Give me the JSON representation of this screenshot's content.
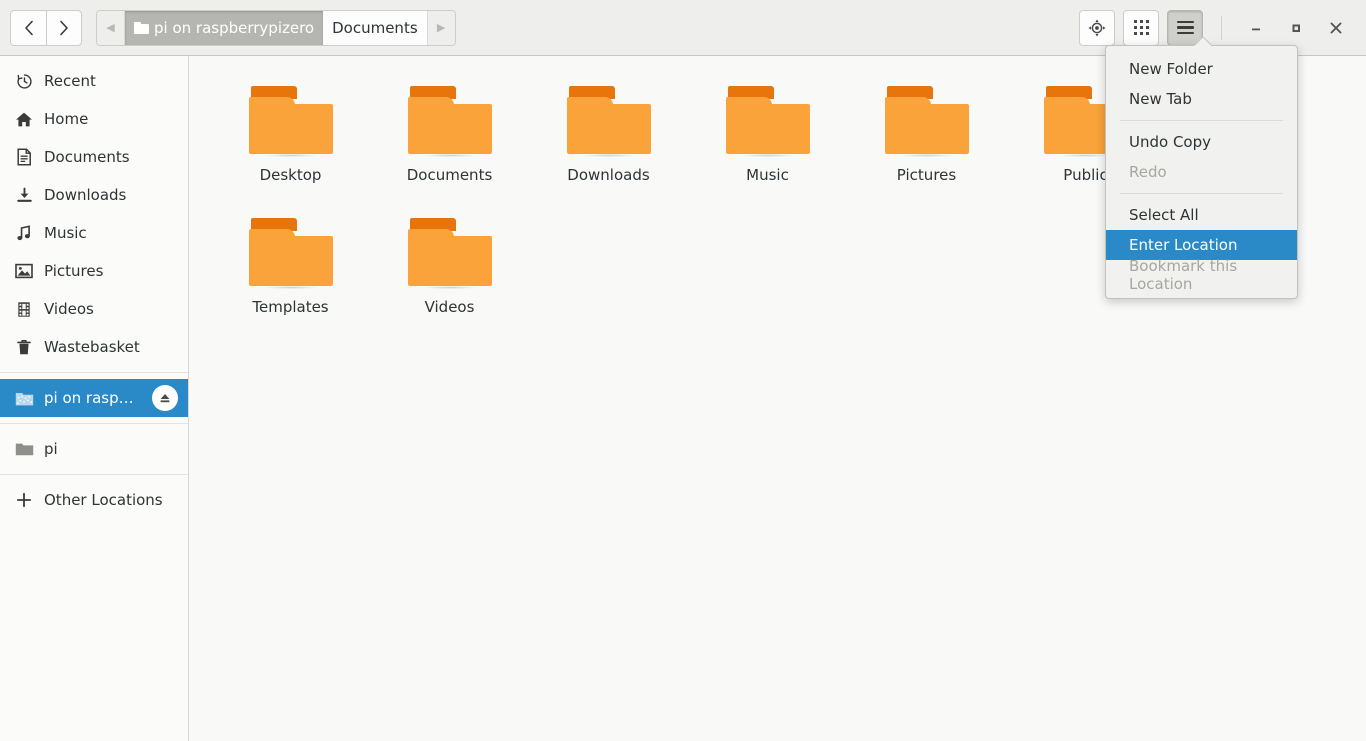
{
  "header": {
    "nav": {
      "back_label": "‹",
      "forward_label": "›"
    },
    "pathbar": {
      "left_arrow": "◀",
      "right_arrow": "▶",
      "crumbs": [
        {
          "label": "pi on raspberrypizero",
          "state": "pressed",
          "icon": "folder-icon"
        },
        {
          "label": "Documents",
          "state": "active",
          "icon": ""
        }
      ]
    },
    "tools": [
      {
        "name": "location-target-button",
        "icon": "target-icon",
        "label": ""
      },
      {
        "name": "view-grid-button",
        "icon": "grid-icon",
        "label": ""
      },
      {
        "name": "main-menu-button",
        "icon": "hamburger-icon",
        "label": "",
        "active": true
      }
    ],
    "window_controls": {
      "minimize": "—",
      "maximize": "□",
      "close": "✕"
    }
  },
  "sidebar": {
    "items": [
      {
        "label": "Recent",
        "icon": "clock-icon"
      },
      {
        "label": "Home",
        "icon": "home-icon"
      },
      {
        "label": "Documents",
        "icon": "document-icon"
      },
      {
        "label": "Downloads",
        "icon": "download-icon"
      },
      {
        "label": "Music",
        "icon": "music-note-icon"
      },
      {
        "label": "Pictures",
        "icon": "picture-icon"
      },
      {
        "label": "Videos",
        "icon": "film-icon"
      },
      {
        "label": "Wastebasket",
        "icon": "trash-icon"
      }
    ],
    "mounts": [
      {
        "label": "pi on raspberr…",
        "icon": "network-folder-icon",
        "selected": true,
        "eject": "eject-icon"
      }
    ],
    "places": [
      {
        "label": "pi",
        "icon": "folder-grey-icon"
      }
    ],
    "other": {
      "label": "Other Locations",
      "icon": "plus-icon"
    }
  },
  "content": {
    "files": [
      {
        "label": "Desktop",
        "type": "folder"
      },
      {
        "label": "Documents",
        "type": "folder"
      },
      {
        "label": "Downloads",
        "type": "folder"
      },
      {
        "label": "Music",
        "type": "folder"
      },
      {
        "label": "Pictures",
        "type": "folder"
      },
      {
        "label": "Public",
        "type": "folder"
      },
      {
        "label": "Templates",
        "type": "folder"
      },
      {
        "label": "Videos",
        "type": "folder"
      }
    ]
  },
  "menu": {
    "items": [
      {
        "label": "New Folder",
        "state": "normal"
      },
      {
        "label": "New Tab",
        "state": "normal"
      },
      {
        "label": "Undo Copy",
        "state": "normal"
      },
      {
        "label": "Redo",
        "state": "disabled"
      },
      {
        "label": "Select All",
        "state": "normal"
      },
      {
        "label": "Enter Location",
        "state": "highlight"
      },
      {
        "label": "Bookmark this Location",
        "state": "disabled"
      }
    ]
  },
  "colors": {
    "accent": "#2a8ac8",
    "folder_body": "#f9a33a",
    "folder_tab": "#e8740c",
    "header_bg": "#eeeeec",
    "sidebar_bg": "#fbfbfa",
    "content_bg": "#f9f9f8"
  }
}
